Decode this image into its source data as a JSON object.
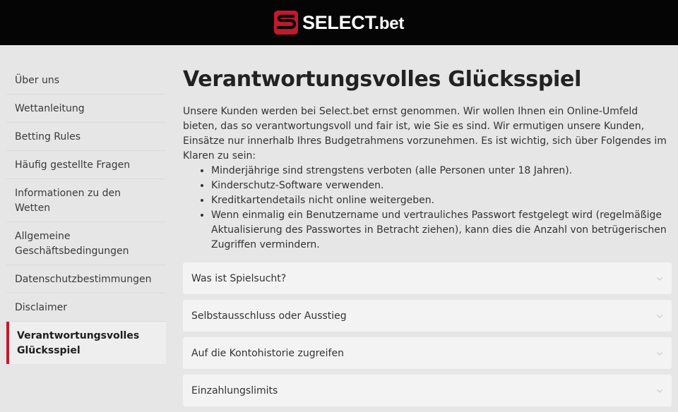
{
  "header": {
    "logo_name": "SELECT",
    "logo_dot": ".",
    "logo_suffix": "bet",
    "logo_mark_icon": "select-s-logo-icon",
    "accent_color": "#c4182c"
  },
  "sidebar": {
    "items": [
      {
        "label": "Über uns"
      },
      {
        "label": "Wettanleitung"
      },
      {
        "label": "Betting Rules"
      },
      {
        "label": "Häufig gestellte Fragen"
      },
      {
        "label": "Informationen zu den Wetten"
      },
      {
        "label": "Allgemeine Geschäftsbedingungen"
      },
      {
        "label": "Datenschutzbestimmungen"
      },
      {
        "label": "Disclaimer"
      },
      {
        "label": "Verantwortungsvolles Glücksspiel",
        "active": true
      }
    ]
  },
  "main": {
    "title": "Verantwortungsvolles Glücksspiel",
    "intro": "Unsere Kunden werden bei Select.bet ernst genommen. Wir wollen Ihnen ein Online-Umfeld bieten, das so verantwortungsvoll und fair ist, wie Sie es sind. Wir ermutigen unsere Kunden, Einsätze nur innerhalb Ihres Budgetrahmens vorzunehmen. Es ist wichtig, sich über Folgendes im Klaren zu sein:",
    "bullets": [
      "Minderjährige sind strengstens verboten (alle Personen unter 18 Jahren).",
      "Kinderschutz-Software verwenden.",
      "Kreditkartendetails nicht online weitergeben.",
      " Wenn einmalig ein Benutzername und vertrauliches Passwort festgelegt wird (regelmäßige Aktualisierung des Passwortes in Betracht ziehen), kann dies die Anzahl von betrügerischen Zugriffen vermindern."
    ],
    "accordion": [
      {
        "label": "Was ist Spielsucht?",
        "icon": "chevron-down-icon"
      },
      {
        "label": "Selbstausschluss oder Ausstieg",
        "icon": "chevron-down-icon"
      },
      {
        "label": "Auf die Kontohistorie zugreifen",
        "icon": "chevron-down-icon"
      },
      {
        "label": "Einzahlungslimits",
        "icon": "chevron-down-icon"
      }
    ]
  }
}
